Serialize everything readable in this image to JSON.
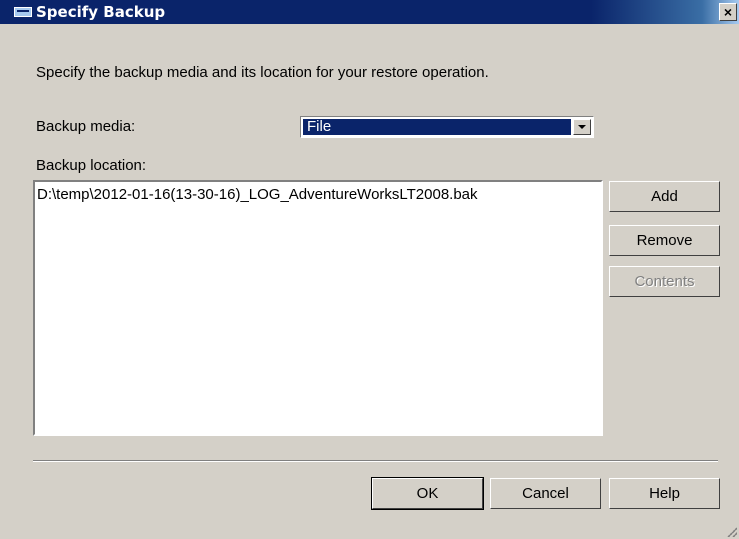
{
  "window": {
    "title": "Specify Backup",
    "close_glyph": "×"
  },
  "instructions": "Specify the backup media and its location for your restore operation.",
  "backup_media": {
    "label": "Backup media:",
    "selected": "File"
  },
  "backup_location": {
    "label": "Backup location:",
    "items": [
      "D:\\temp\\2012-01-16(13-30-16)_LOG_AdventureWorksLT2008.bak"
    ]
  },
  "side_buttons": {
    "add": "Add",
    "remove": "Remove",
    "contents": "Contents"
  },
  "footer_buttons": {
    "ok": "OK",
    "cancel": "Cancel",
    "help": "Help"
  }
}
